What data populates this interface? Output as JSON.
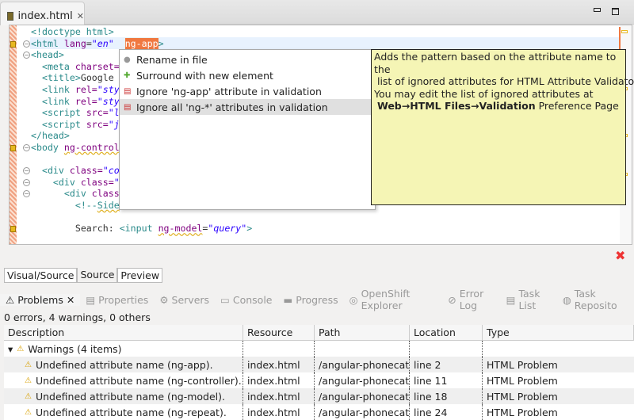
{
  "editor": {
    "tab_title": "index.html",
    "code_lines": [
      [
        [
          "tg",
          "<!doctype html>"
        ]
      ],
      [
        [
          "tg",
          "<html "
        ],
        [
          "at",
          "lang"
        ],
        [
          "tx",
          "="
        ],
        [
          "vl",
          "\"en\""
        ],
        [
          "tx",
          "  "
        ],
        [
          "sel",
          "ng-app"
        ],
        [
          "tg",
          ">"
        ]
      ],
      [
        [
          "tg",
          "<head>"
        ]
      ],
      [
        [
          "tx",
          "  "
        ],
        [
          "tg",
          "<meta "
        ],
        [
          "at",
          "charset="
        ]
      ],
      [
        [
          "tx",
          "  "
        ],
        [
          "tg",
          "<title>"
        ],
        [
          "tx",
          "Google"
        ]
      ],
      [
        [
          "tx",
          "  "
        ],
        [
          "tg",
          "<link "
        ],
        [
          "at",
          "rel="
        ],
        [
          "vl",
          "\"sty"
        ]
      ],
      [
        [
          "tx",
          "  "
        ],
        [
          "tg",
          "<link "
        ],
        [
          "at",
          "rel="
        ],
        [
          "vl",
          "\"sty"
        ]
      ],
      [
        [
          "tx",
          "  "
        ],
        [
          "tg",
          "<script "
        ],
        [
          "at",
          "src="
        ],
        [
          "vl",
          "\"l"
        ]
      ],
      [
        [
          "tx",
          "  "
        ],
        [
          "tg",
          "<script "
        ],
        [
          "at",
          "src="
        ],
        [
          "vl",
          "\"j"
        ]
      ],
      [
        [
          "tg",
          "</head>"
        ]
      ],
      [
        [
          "tg",
          "<body "
        ],
        [
          "at sq",
          "ng-control"
        ]
      ],
      [],
      [
        [
          "tx",
          "  "
        ],
        [
          "tg",
          "<div "
        ],
        [
          "at",
          "class="
        ],
        [
          "vl",
          "\"co"
        ]
      ],
      [
        [
          "tx",
          "    "
        ],
        [
          "tg",
          "<div "
        ],
        [
          "at",
          "class="
        ],
        [
          "vl",
          "\""
        ]
      ],
      [
        [
          "tx",
          "      "
        ],
        [
          "tg",
          "<div "
        ],
        [
          "at",
          "class"
        ]
      ],
      [
        [
          "tx",
          "        "
        ],
        [
          "tg",
          "<!--"
        ],
        [
          "tg sq",
          "Side"
        ]
      ],
      [],
      [
        [
          "tx",
          "        Search: "
        ],
        [
          "tg",
          "<input "
        ],
        [
          "at sq",
          "ng-model"
        ],
        [
          "tx",
          "="
        ],
        [
          "vl",
          "\"query\""
        ],
        [
          "tg",
          ">"
        ]
      ]
    ],
    "bottom_tabs": [
      "Visual/Source",
      "Source",
      "Preview"
    ]
  },
  "quickfix_menu": {
    "items": [
      {
        "label": "Rename in file",
        "icon": "rename-icon"
      },
      {
        "label": "Surround with new element",
        "icon": "plus-icon"
      },
      {
        "label": "Ignore 'ng-app' attribute in validation",
        "icon": "ignore-icon"
      },
      {
        "label": "Ignore all 'ng-*' attributes in validation",
        "icon": "ignore-icon",
        "selected": true
      }
    ]
  },
  "tooltip": {
    "line1": "Adds the pattern based on the attribute name to the",
    "line2": " list of ignored attributes for HTML Attribute Validator",
    "line3": "You may edit the list of ignored attributes at",
    "link": "Web→HTML Files→Validation",
    "suffix": " Preference Page"
  },
  "views": {
    "tabs": [
      "Problems",
      "Properties",
      "Servers",
      "Console",
      "Progress",
      "OpenShift Explorer",
      "Error Log",
      "Task List",
      "Task Reposito"
    ],
    "status": "0 errors, 4 warnings, 0 others",
    "columns": [
      "Description",
      "Resource",
      "Path",
      "Location",
      "Type"
    ],
    "group": "Warnings (4 items)",
    "rows": [
      [
        "Undefined attribute name (ng-app).",
        "index.html",
        "/angular-phonecat/a",
        "line 2",
        "HTML Problem"
      ],
      [
        "Undefined attribute name (ng-controller).",
        "index.html",
        "/angular-phonecat/a",
        "line 11",
        "HTML Problem"
      ],
      [
        "Undefined attribute name (ng-model).",
        "index.html",
        "/angular-phonecat/a",
        "line 18",
        "HTML Problem"
      ],
      [
        "Undefined attribute name (ng-repeat).",
        "index.html",
        "/angular-phonecat/a",
        "line 24",
        "HTML Problem"
      ]
    ]
  }
}
